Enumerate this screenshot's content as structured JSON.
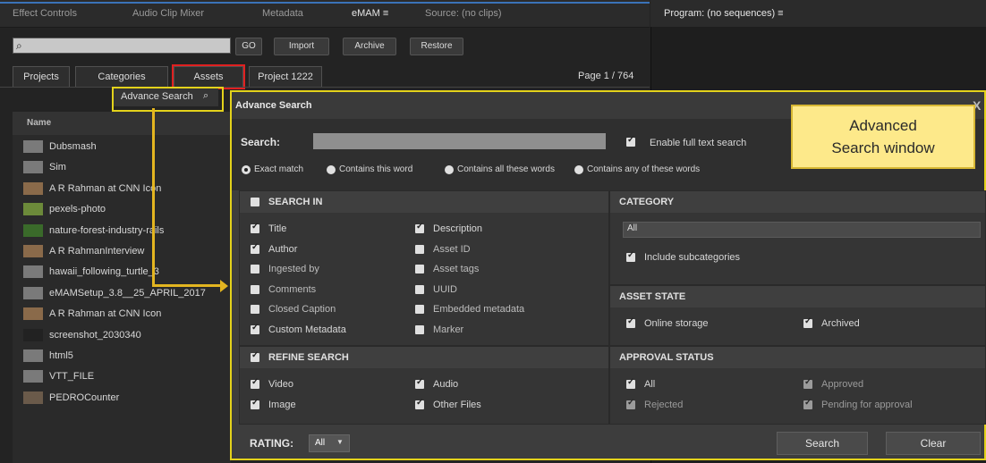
{
  "tabs": [
    {
      "label": "Effect Controls"
    },
    {
      "label": "Audio Clip Mixer"
    },
    {
      "label": "Metadata"
    },
    {
      "label": "eMAM ≡"
    },
    {
      "label": "Source: (no clips)"
    }
  ],
  "program_tab": "Program: (no sequences) ≡",
  "toolbar": {
    "go": "GO",
    "import": "Import",
    "archive": "Archive",
    "restore": "Restore"
  },
  "subtabs": [
    {
      "label": "Projects"
    },
    {
      "label": "Categories"
    },
    {
      "label": "Assets"
    },
    {
      "label": "Project 1222"
    }
  ],
  "page_indicator": "Page 1 / 764",
  "advance_search_btn": "Advance Search",
  "list": {
    "header": "Name",
    "items": [
      {
        "label": "Dubsmash"
      },
      {
        "label": "Sim"
      },
      {
        "label": "A R Rahman at CNN Icon"
      },
      {
        "label": "pexels-photo"
      },
      {
        "label": "nature-forest-industry-rails"
      },
      {
        "label": "A R RahmanInterview"
      },
      {
        "label": "hawaii_following_turtle_3"
      },
      {
        "label": "eMAMSetup_3.8__25_APRIL_2017"
      },
      {
        "label": "A R Rahman at CNN Icon"
      },
      {
        "label": "screenshot_2030340"
      },
      {
        "label": "html5"
      },
      {
        "label": "VTT_FILE"
      },
      {
        "label": "PEDROCounter"
      }
    ]
  },
  "dialog": {
    "title": "Advance Search",
    "close": "X",
    "search_label": "Search:",
    "full_text": "Enable full text search",
    "match_options": [
      "Exact match",
      "Contains this word",
      "Contains all these words",
      "Contains any of these words"
    ],
    "search_in": {
      "title": "SEARCH IN",
      "left": [
        {
          "label": "Title",
          "checked": true
        },
        {
          "label": "Author",
          "checked": true
        },
        {
          "label": "Ingested by",
          "checked": false
        },
        {
          "label": "Comments",
          "checked": false
        },
        {
          "label": "Closed Caption",
          "checked": false
        },
        {
          "label": "Custom Metadata",
          "checked": true
        }
      ],
      "right": [
        {
          "label": "Description",
          "checked": true
        },
        {
          "label": "Asset ID",
          "checked": false
        },
        {
          "label": "Asset tags",
          "checked": false
        },
        {
          "label": "UUID",
          "checked": false
        },
        {
          "label": "Embedded metadata",
          "checked": false
        },
        {
          "label": "Marker",
          "checked": false
        }
      ]
    },
    "refine": {
      "title": "REFINE SEARCH",
      "items": [
        {
          "label": "Video"
        },
        {
          "label": "Audio"
        },
        {
          "label": "Image"
        },
        {
          "label": "Other Files"
        }
      ]
    },
    "rating_label": "RATING:",
    "rating_value": "All",
    "category": {
      "title": "CATEGORY",
      "value": "All",
      "include": "Include subcategories"
    },
    "asset_state": {
      "title": "ASSET STATE",
      "online": "Online storage",
      "archived": "Archived"
    },
    "approval": {
      "title": "APPROVAL STATUS",
      "all": "All",
      "approved": "Approved",
      "rejected": "Rejected",
      "pending": "Pending for approval"
    },
    "search_btn": "Search",
    "clear_btn": "Clear"
  },
  "callout": {
    "line1": "Advanced",
    "line2": "Search window"
  },
  "colors": {
    "highlight": "#e3d21b",
    "assets_border": "#e02020",
    "callout_bg": "#fde98a"
  }
}
